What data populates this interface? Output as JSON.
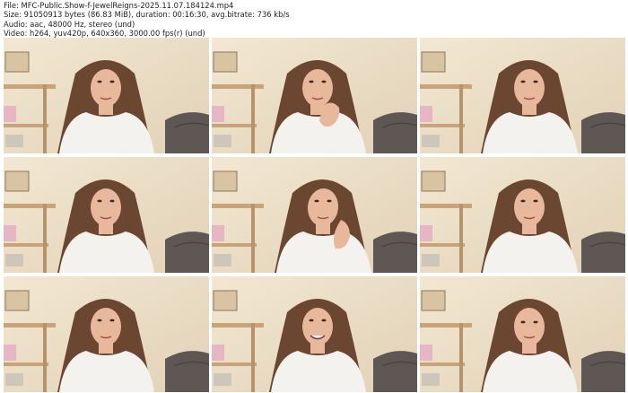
{
  "header": {
    "file": "File: MFC-Public.Show-f-JewelReigns-2025.11.07.184124.mp4",
    "size": "Size: 91050913 bytes (86.83 MiB), duration: 00:16:30, avg.bitrate: 736 kb/s",
    "audio": "Audio: aac, 48000 Hz, stereo (und)",
    "video": "Video: h264, yuv420p, 640x360, 3000.00 fps(r) (und)"
  },
  "thumbnails": [
    {
      "pose": "neutral"
    },
    {
      "pose": "hand-chin"
    },
    {
      "pose": "neutral"
    },
    {
      "pose": "neutral"
    },
    {
      "pose": "hand-cheek"
    },
    {
      "pose": "neutral"
    },
    {
      "pose": "neutral"
    },
    {
      "pose": "smile"
    },
    {
      "pose": "looking-down"
    }
  ],
  "colors": {
    "wall": "#ecdfc6",
    "hair": "#6b4631",
    "skin": "#e8b89c",
    "sweater": "#f4f2ee",
    "sofa": "#5e5754",
    "shelf": "#c9a47a"
  }
}
